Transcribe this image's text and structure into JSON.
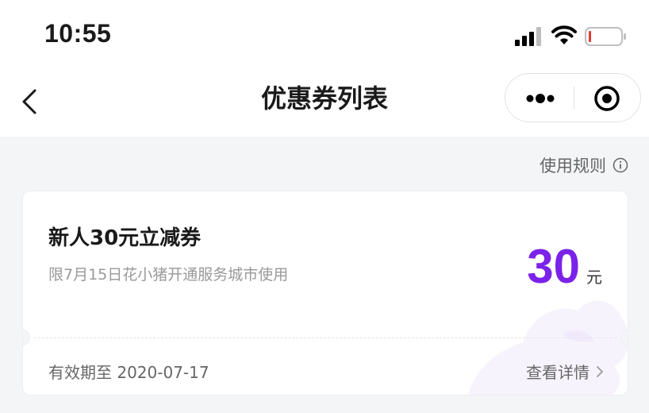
{
  "status_bar": {
    "time": "10:55"
  },
  "nav": {
    "title": "优惠券列表"
  },
  "rules": {
    "label": "使用规则"
  },
  "coupon": {
    "title": "新人30元立减券",
    "description": "限7月15日花小猪开通服务城市使用",
    "amount": "30",
    "unit": "元",
    "expiry": "有效期至 2020-07-17",
    "detail_label": "查看详情",
    "amount_color": "#7b22e8"
  }
}
